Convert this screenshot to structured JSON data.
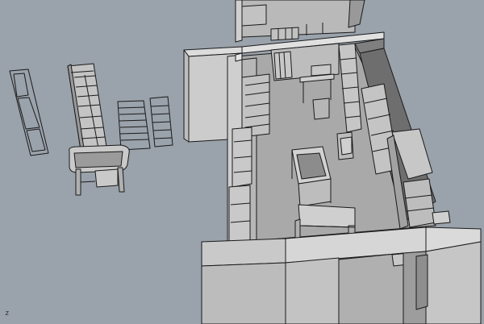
{
  "viewport": {
    "name": "3d-perspective-viewport",
    "background": "#9aa2ab",
    "surface_light": "#c8c8c8",
    "surface_mid": "#b4b4b4",
    "surface_dark": "#8a8a8a",
    "floor": "#a7a7a7",
    "edge": "#1a1a1a"
  },
  "axis_indicator": {
    "label": "z",
    "icon": "axis-gizmo-icon"
  }
}
